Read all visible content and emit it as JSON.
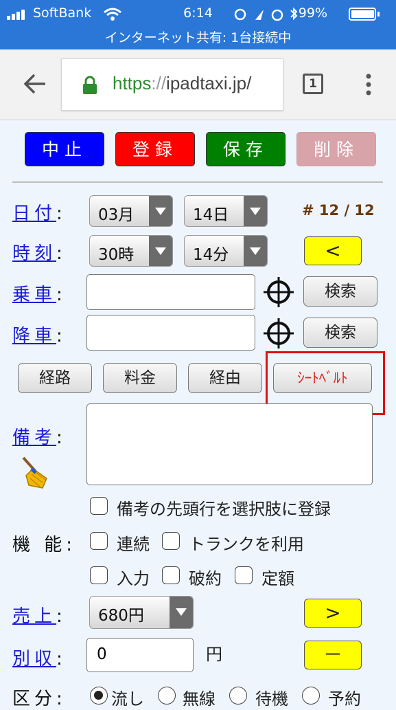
{
  "status": {
    "carrier": "SoftBank",
    "time": "6:14",
    "battery": "99%",
    "hotspot": "インターネット共有: 1台接続中"
  },
  "browser": {
    "url_scheme": "https",
    "url_sep": "://",
    "url_host": "ipadtaxi.jp/",
    "tab_count": "1"
  },
  "actions": {
    "stop": "中止",
    "register": "登録",
    "save": "保存",
    "delete": "削除"
  },
  "colors": {
    "stop": "#0000ff",
    "register": "#ff0000",
    "save": "#008000",
    "delete": "#d9a3aa"
  },
  "form": {
    "date_label": "日付",
    "time_label": "時刻",
    "colon": ":",
    "month": "03月",
    "day": "14日",
    "hour": "30時",
    "minute": "14分",
    "record_counter": "# 12 / 12",
    "prev_btn": "<",
    "pickup_label": "乗車",
    "dropoff_label": "降車",
    "pickup_value": "",
    "dropoff_value": "",
    "search": "検索",
    "route_btn": "経路",
    "fare_btn": "料金",
    "via_btn": "経由",
    "seatbelt_btn": "ｼｰﾄﾍﾞﾙﾄ",
    "memo_label": "備考",
    "memo_value": "",
    "memo_option": "備考の先頭行を選択肢に登録",
    "function_label": "機 能",
    "opt_continuous": "連続",
    "opt_trunk": "トランクを利用",
    "opt_input": "入力",
    "opt_cancel": "破約",
    "opt_fixed": "定額",
    "sales_label": "売上",
    "sales_value": "680円",
    "next_btn": ">",
    "other_income_label": "別収",
    "other_income_value": "0",
    "yen": "円",
    "minus_btn": "－",
    "category_label": "区分",
    "cat_nagashi": "流し",
    "cat_musen": "無線",
    "cat_taiki": "待機",
    "cat_yoyaku": "予約"
  }
}
